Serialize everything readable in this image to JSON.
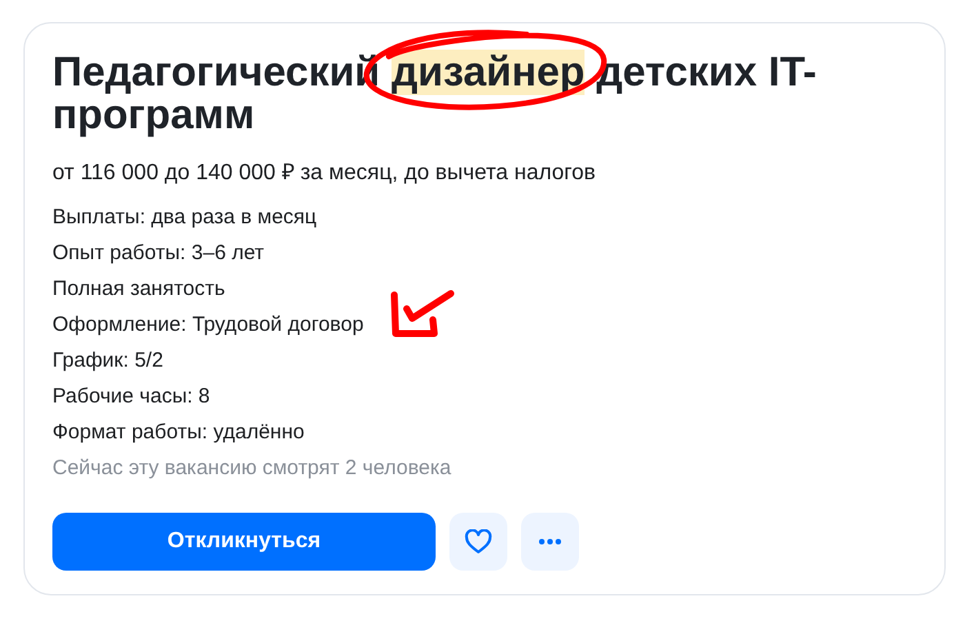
{
  "vacancy": {
    "title_parts": [
      {
        "text": "Педагогический ",
        "highlighted": false
      },
      {
        "text": "дизайнер",
        "highlighted": true
      },
      {
        "text": " детских IT-программ",
        "highlighted": false
      }
    ],
    "salary": "от 116 000 до 140 000 ₽ за месяц, до вычета налогов",
    "details": [
      "Выплаты: два раза в месяц",
      "Опыт работы: 3–6 лет",
      "Полная занятость",
      "Оформление: Трудовой договор",
      "График: 5/2",
      "Рабочие часы: 8",
      "Формат работы: удалённо"
    ],
    "viewers": "Сейчас эту вакансию смотрят 2 человека",
    "apply_button": "Откликнуться"
  }
}
